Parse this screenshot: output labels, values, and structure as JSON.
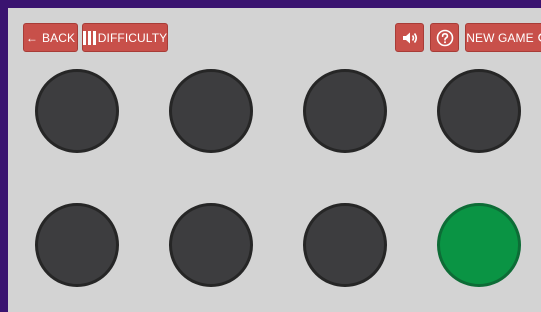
{
  "toolbar": {
    "back": {
      "arrow": "←",
      "label": "BACK"
    },
    "difficulty": {
      "label": "DIFFICULTY",
      "icon": "bars-icon"
    },
    "sound": {
      "icon": "speaker-icon"
    },
    "help": {
      "icon": "help-icon"
    },
    "new_game": {
      "label": "NEW GAME",
      "icon": "refresh-icon"
    }
  },
  "board": {
    "rows": 2,
    "columns": 4,
    "lit_color": "#0a9444",
    "unlit_color": "#3d3d3f",
    "circles": [
      {
        "lit": false
      },
      {
        "lit": false
      },
      {
        "lit": false
      },
      {
        "lit": false
      },
      {
        "lit": false
      },
      {
        "lit": false
      },
      {
        "lit": false
      },
      {
        "lit": true
      }
    ]
  },
  "colors": {
    "frame": "#3a1370",
    "background": "#d3d3d3",
    "button": "#c8504a"
  }
}
